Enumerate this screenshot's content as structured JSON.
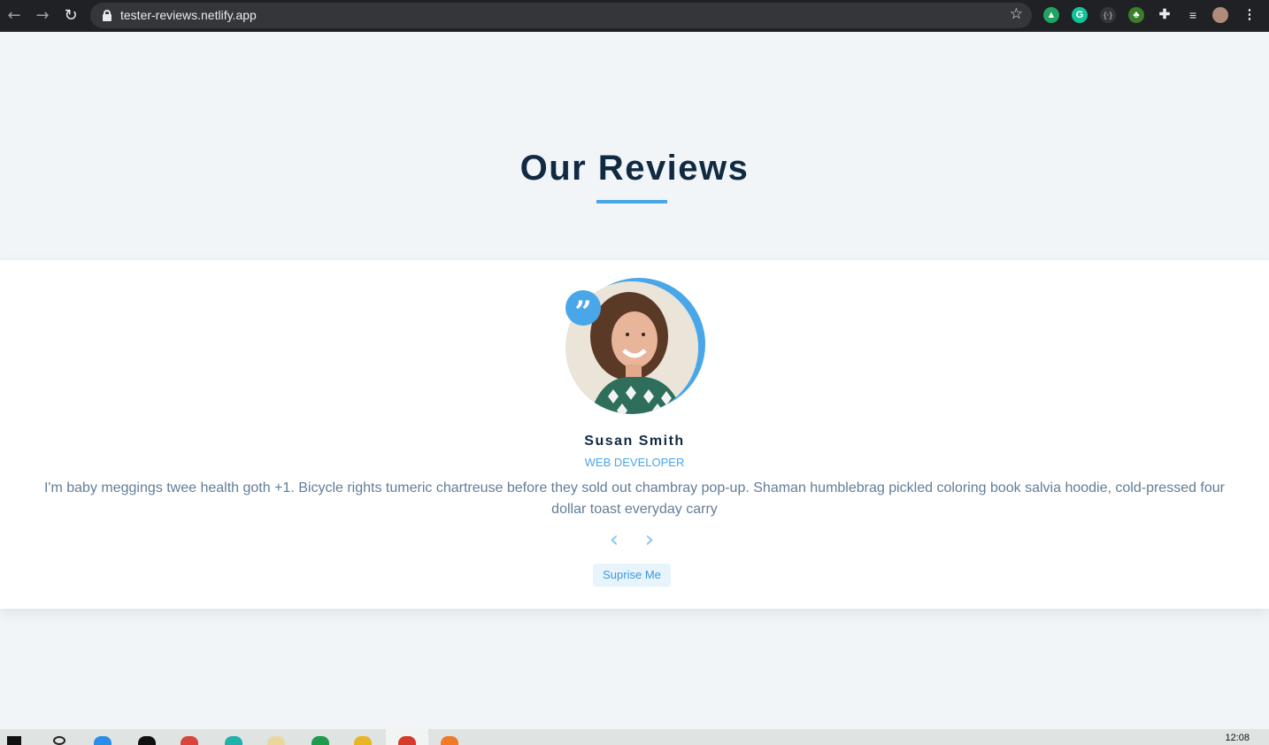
{
  "browser": {
    "url": "tester-reviews.netlify.app"
  },
  "page": {
    "title": "Our Reviews"
  },
  "review": {
    "name": "Susan Smith",
    "job": "WEB DEVELOPER",
    "text": "I'm baby meggings twee health goth +1. Bicycle rights tumeric chartreuse before they sold out chambray pop-up. Shaman humblebrag pickled coloring book salvia hoodie, cold-pressed four dollar toast everyday carry",
    "prev_glyph": "‹",
    "next_glyph": "›",
    "random_label": "Suprise Me"
  },
  "taskbar": {
    "clock": "12:08"
  },
  "colors": {
    "accent": "#49a6e9",
    "heading": "#102a42",
    "body_text": "#617d98",
    "page_bg": "#f1f5f8"
  },
  "icons": [
    "back-icon",
    "forward-icon",
    "reload-icon",
    "lock-icon",
    "star-icon",
    "quote-icon",
    "chevron-left-icon",
    "chevron-right-icon"
  ]
}
